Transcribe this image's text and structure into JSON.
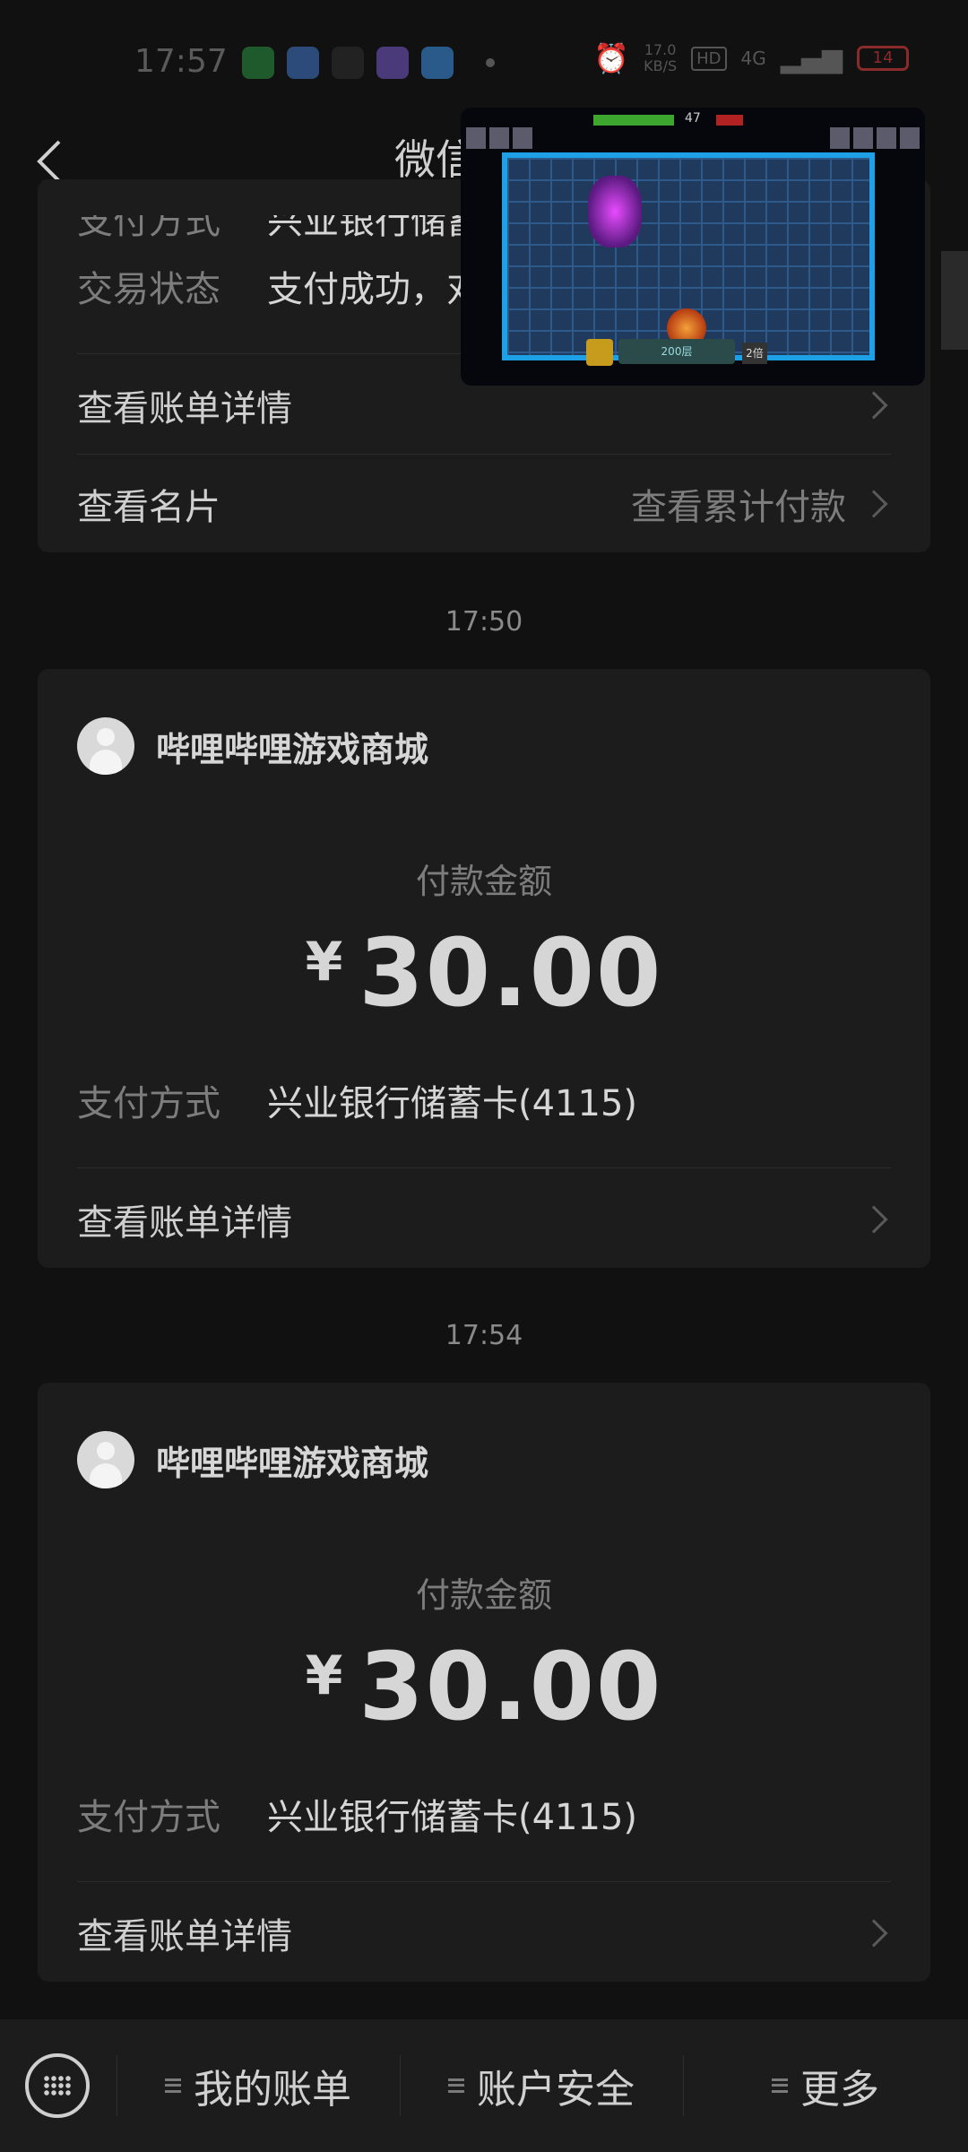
{
  "status_bar": {
    "time": "17:57",
    "net_speed_value": "17.0",
    "net_speed_unit": "KB/S",
    "hd_label": "HD",
    "network": "4G",
    "battery": "14"
  },
  "nav": {
    "title": "微信"
  },
  "card1": {
    "payment_method_label": "支付方式",
    "payment_method_value": "兴业银行储蓄",
    "status_label": "交易状态",
    "status_value": "支付成功，对",
    "bill_details": "查看账单详情",
    "view_card": "查看名片",
    "view_cumulative": "查看累计付款"
  },
  "transactions": [
    {
      "time": "17:50",
      "merchant": "哔哩哔哩游戏商城",
      "amount_label": "付款金额",
      "currency": "¥",
      "amount": "30.00",
      "payment_method_label": "支付方式",
      "payment_method_value": "兴业银行储蓄卡(4115)",
      "bill_details": "查看账单详情"
    },
    {
      "time": "17:54",
      "merchant": "哔哩哔哩游戏商城",
      "amount_label": "付款金额",
      "currency": "¥",
      "amount": "30.00",
      "payment_method_label": "支付方式",
      "payment_method_value": "兴业银行储蓄卡(4115)",
      "bill_details": "查看账单详情"
    }
  ],
  "pip": {
    "score": "47",
    "floor": "200层",
    "round": "2倍"
  },
  "bottom_bar": {
    "my_bills": "我的账单",
    "account_security": "账户安全",
    "more": "更多"
  },
  "colors": {
    "background": "#111111",
    "card": "#1c1c1c",
    "text_primary": "#d6d6d6",
    "text_secondary": "#7d7d7d"
  }
}
